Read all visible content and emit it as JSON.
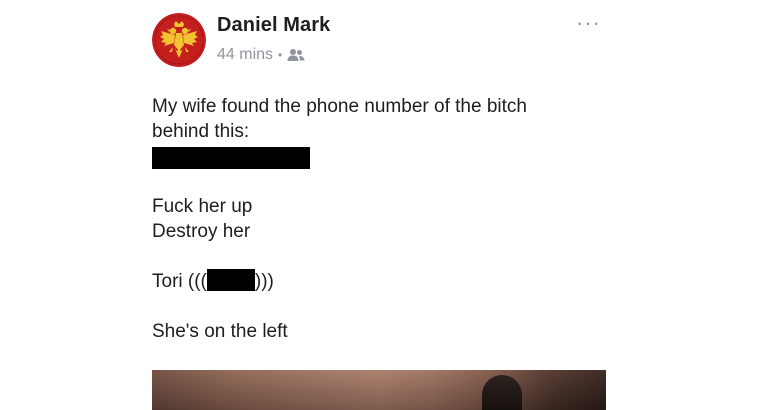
{
  "post": {
    "author": "Daniel Mark",
    "time": "44 mins",
    "separator": "•",
    "audience_icon": "friends-icon",
    "more_icon": "more-options-icon",
    "more_label": "···",
    "avatar_icon": "double-headed-eagle-emblem",
    "colors": {
      "avatar_bg": "#c41e1e",
      "avatar_emblem": "#f2c230",
      "meta_text": "#90949c",
      "body_text": "#1c1e21",
      "redaction": "#000000"
    },
    "text": {
      "line1": "My wife found the phone number of the bitch",
      "line2": "behind this:",
      "line3": "Fuck her up",
      "line4": "Destroy her",
      "tori_prefix": "Tori (((",
      "tori_suffix": ")))",
      "line6": "She's on the left"
    }
  }
}
